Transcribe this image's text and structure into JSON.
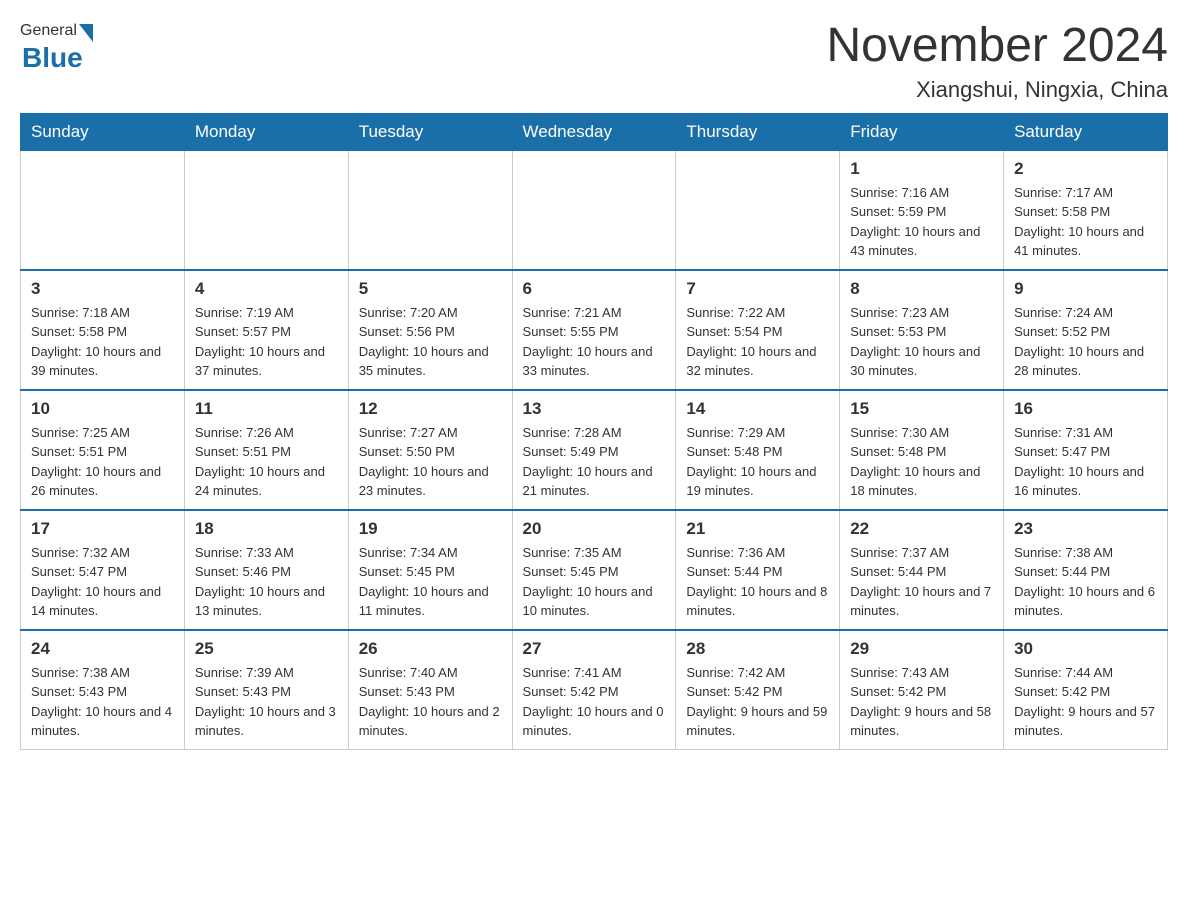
{
  "header": {
    "logo": {
      "general": "General",
      "blue": "Blue"
    },
    "title": "November 2024",
    "subtitle": "Xiangshui, Ningxia, China"
  },
  "weekdays": [
    "Sunday",
    "Monday",
    "Tuesday",
    "Wednesday",
    "Thursday",
    "Friday",
    "Saturday"
  ],
  "weeks": [
    [
      {
        "day": "",
        "info": ""
      },
      {
        "day": "",
        "info": ""
      },
      {
        "day": "",
        "info": ""
      },
      {
        "day": "",
        "info": ""
      },
      {
        "day": "",
        "info": ""
      },
      {
        "day": "1",
        "info": "Sunrise: 7:16 AM\nSunset: 5:59 PM\nDaylight: 10 hours and 43 minutes."
      },
      {
        "day": "2",
        "info": "Sunrise: 7:17 AM\nSunset: 5:58 PM\nDaylight: 10 hours and 41 minutes."
      }
    ],
    [
      {
        "day": "3",
        "info": "Sunrise: 7:18 AM\nSunset: 5:58 PM\nDaylight: 10 hours and 39 minutes."
      },
      {
        "day": "4",
        "info": "Sunrise: 7:19 AM\nSunset: 5:57 PM\nDaylight: 10 hours and 37 minutes."
      },
      {
        "day": "5",
        "info": "Sunrise: 7:20 AM\nSunset: 5:56 PM\nDaylight: 10 hours and 35 minutes."
      },
      {
        "day": "6",
        "info": "Sunrise: 7:21 AM\nSunset: 5:55 PM\nDaylight: 10 hours and 33 minutes."
      },
      {
        "day": "7",
        "info": "Sunrise: 7:22 AM\nSunset: 5:54 PM\nDaylight: 10 hours and 32 minutes."
      },
      {
        "day": "8",
        "info": "Sunrise: 7:23 AM\nSunset: 5:53 PM\nDaylight: 10 hours and 30 minutes."
      },
      {
        "day": "9",
        "info": "Sunrise: 7:24 AM\nSunset: 5:52 PM\nDaylight: 10 hours and 28 minutes."
      }
    ],
    [
      {
        "day": "10",
        "info": "Sunrise: 7:25 AM\nSunset: 5:51 PM\nDaylight: 10 hours and 26 minutes."
      },
      {
        "day": "11",
        "info": "Sunrise: 7:26 AM\nSunset: 5:51 PM\nDaylight: 10 hours and 24 minutes."
      },
      {
        "day": "12",
        "info": "Sunrise: 7:27 AM\nSunset: 5:50 PM\nDaylight: 10 hours and 23 minutes."
      },
      {
        "day": "13",
        "info": "Sunrise: 7:28 AM\nSunset: 5:49 PM\nDaylight: 10 hours and 21 minutes."
      },
      {
        "day": "14",
        "info": "Sunrise: 7:29 AM\nSunset: 5:48 PM\nDaylight: 10 hours and 19 minutes."
      },
      {
        "day": "15",
        "info": "Sunrise: 7:30 AM\nSunset: 5:48 PM\nDaylight: 10 hours and 18 minutes."
      },
      {
        "day": "16",
        "info": "Sunrise: 7:31 AM\nSunset: 5:47 PM\nDaylight: 10 hours and 16 minutes."
      }
    ],
    [
      {
        "day": "17",
        "info": "Sunrise: 7:32 AM\nSunset: 5:47 PM\nDaylight: 10 hours and 14 minutes."
      },
      {
        "day": "18",
        "info": "Sunrise: 7:33 AM\nSunset: 5:46 PM\nDaylight: 10 hours and 13 minutes."
      },
      {
        "day": "19",
        "info": "Sunrise: 7:34 AM\nSunset: 5:45 PM\nDaylight: 10 hours and 11 minutes."
      },
      {
        "day": "20",
        "info": "Sunrise: 7:35 AM\nSunset: 5:45 PM\nDaylight: 10 hours and 10 minutes."
      },
      {
        "day": "21",
        "info": "Sunrise: 7:36 AM\nSunset: 5:44 PM\nDaylight: 10 hours and 8 minutes."
      },
      {
        "day": "22",
        "info": "Sunrise: 7:37 AM\nSunset: 5:44 PM\nDaylight: 10 hours and 7 minutes."
      },
      {
        "day": "23",
        "info": "Sunrise: 7:38 AM\nSunset: 5:44 PM\nDaylight: 10 hours and 6 minutes."
      }
    ],
    [
      {
        "day": "24",
        "info": "Sunrise: 7:38 AM\nSunset: 5:43 PM\nDaylight: 10 hours and 4 minutes."
      },
      {
        "day": "25",
        "info": "Sunrise: 7:39 AM\nSunset: 5:43 PM\nDaylight: 10 hours and 3 minutes."
      },
      {
        "day": "26",
        "info": "Sunrise: 7:40 AM\nSunset: 5:43 PM\nDaylight: 10 hours and 2 minutes."
      },
      {
        "day": "27",
        "info": "Sunrise: 7:41 AM\nSunset: 5:42 PM\nDaylight: 10 hours and 0 minutes."
      },
      {
        "day": "28",
        "info": "Sunrise: 7:42 AM\nSunset: 5:42 PM\nDaylight: 9 hours and 59 minutes."
      },
      {
        "day": "29",
        "info": "Sunrise: 7:43 AM\nSunset: 5:42 PM\nDaylight: 9 hours and 58 minutes."
      },
      {
        "day": "30",
        "info": "Sunrise: 7:44 AM\nSunset: 5:42 PM\nDaylight: 9 hours and 57 minutes."
      }
    ]
  ]
}
